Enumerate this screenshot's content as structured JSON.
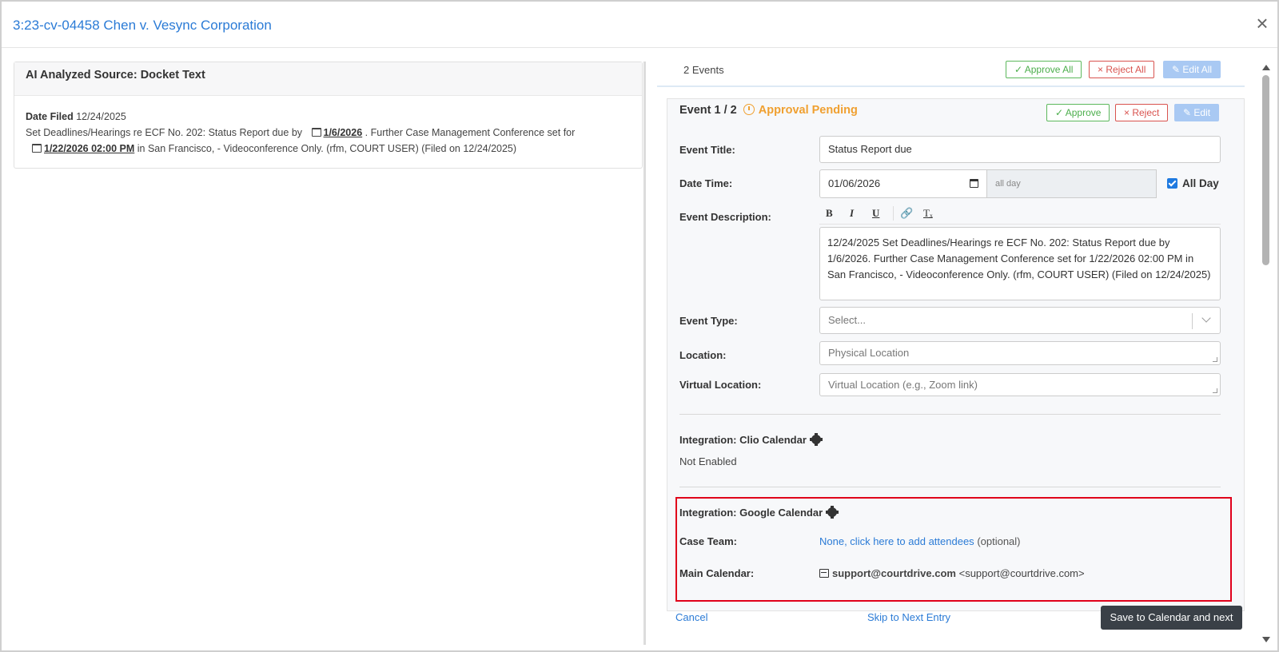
{
  "modal": {
    "title": "3:23-cv-04458 Chen v. Vesync Corporation",
    "close_symbol": "×"
  },
  "source": {
    "header": "AI Analyzed Source: Docket Text",
    "date_filed_label": "Date Filed",
    "date_filed_value": "12/24/2025",
    "text_part1": "Set Deadlines/Hearings re ECF No. 202: Status Report due by",
    "link1": "1/6/2026",
    "text_part2": ". Further Case Management Conference set for",
    "link2": "1/22/2026 02:00 PM",
    "text_part3": " in San Francisco, - Videoconference Only. (rfm, COURT USER) (Filed on 12/24/2025)"
  },
  "events": {
    "count_label": "2 Events",
    "approve_all_label": "Approve All",
    "reject_all_label": "Reject All",
    "edit_all_label": "Edit All"
  },
  "event": {
    "heading": "Event 1 / 2",
    "status": "Approval Pending",
    "approve_label": "Approve",
    "reject_label": "Reject",
    "edit_label": "Edit",
    "title_label": "Event Title:",
    "title_value": "Status Report due",
    "datetime_label": "Date Time:",
    "date_value": "01/06/2026",
    "time_value": "all day",
    "allday_label": "All Day",
    "description_label": "Event Description:",
    "toolbar": {
      "bold": "B",
      "italic": "I",
      "underline": "U",
      "clear": "Tₓ"
    },
    "description_value": "12/24/2025 Set Deadlines/Hearings re ECF No. 202: Status Report due by 1/6/2026. Further Case Management Conference set for 1/22/2026 02:00 PM in San Francisco, - Videoconference Only. (rfm, COURT USER) (Filed on 12/24/2025)",
    "type_label": "Event Type:",
    "type_placeholder": "Select...",
    "location_label": "Location:",
    "location_placeholder": "Physical Location",
    "virtual_label": "Virtual Location:",
    "virtual_placeholder": "Virtual Location (e.g., Zoom link)"
  },
  "integrations": {
    "clio_title": "Integration: Clio Calendar",
    "clio_status": "Not Enabled",
    "google_title": "Integration: Google Calendar",
    "case_team_label": "Case Team:",
    "case_team_link": "None, click here to add attendees",
    "case_team_optional": "(optional)",
    "main_calendar_label": "Main Calendar:",
    "main_calendar_name": "support@courtdrive.com",
    "main_calendar_email": "<support@courtdrive.com>"
  },
  "footer": {
    "cancel_label": "Cancel",
    "skip_label": "Skip to Next Entry",
    "save_label": "Save to Calendar and next"
  },
  "colors": {
    "link": "#2b7bd6",
    "approve": "#5cb85c",
    "reject": "#d9534f",
    "pending": "#f0a030",
    "highlight": "#e0001a",
    "primary_dark": "#3a4047"
  }
}
